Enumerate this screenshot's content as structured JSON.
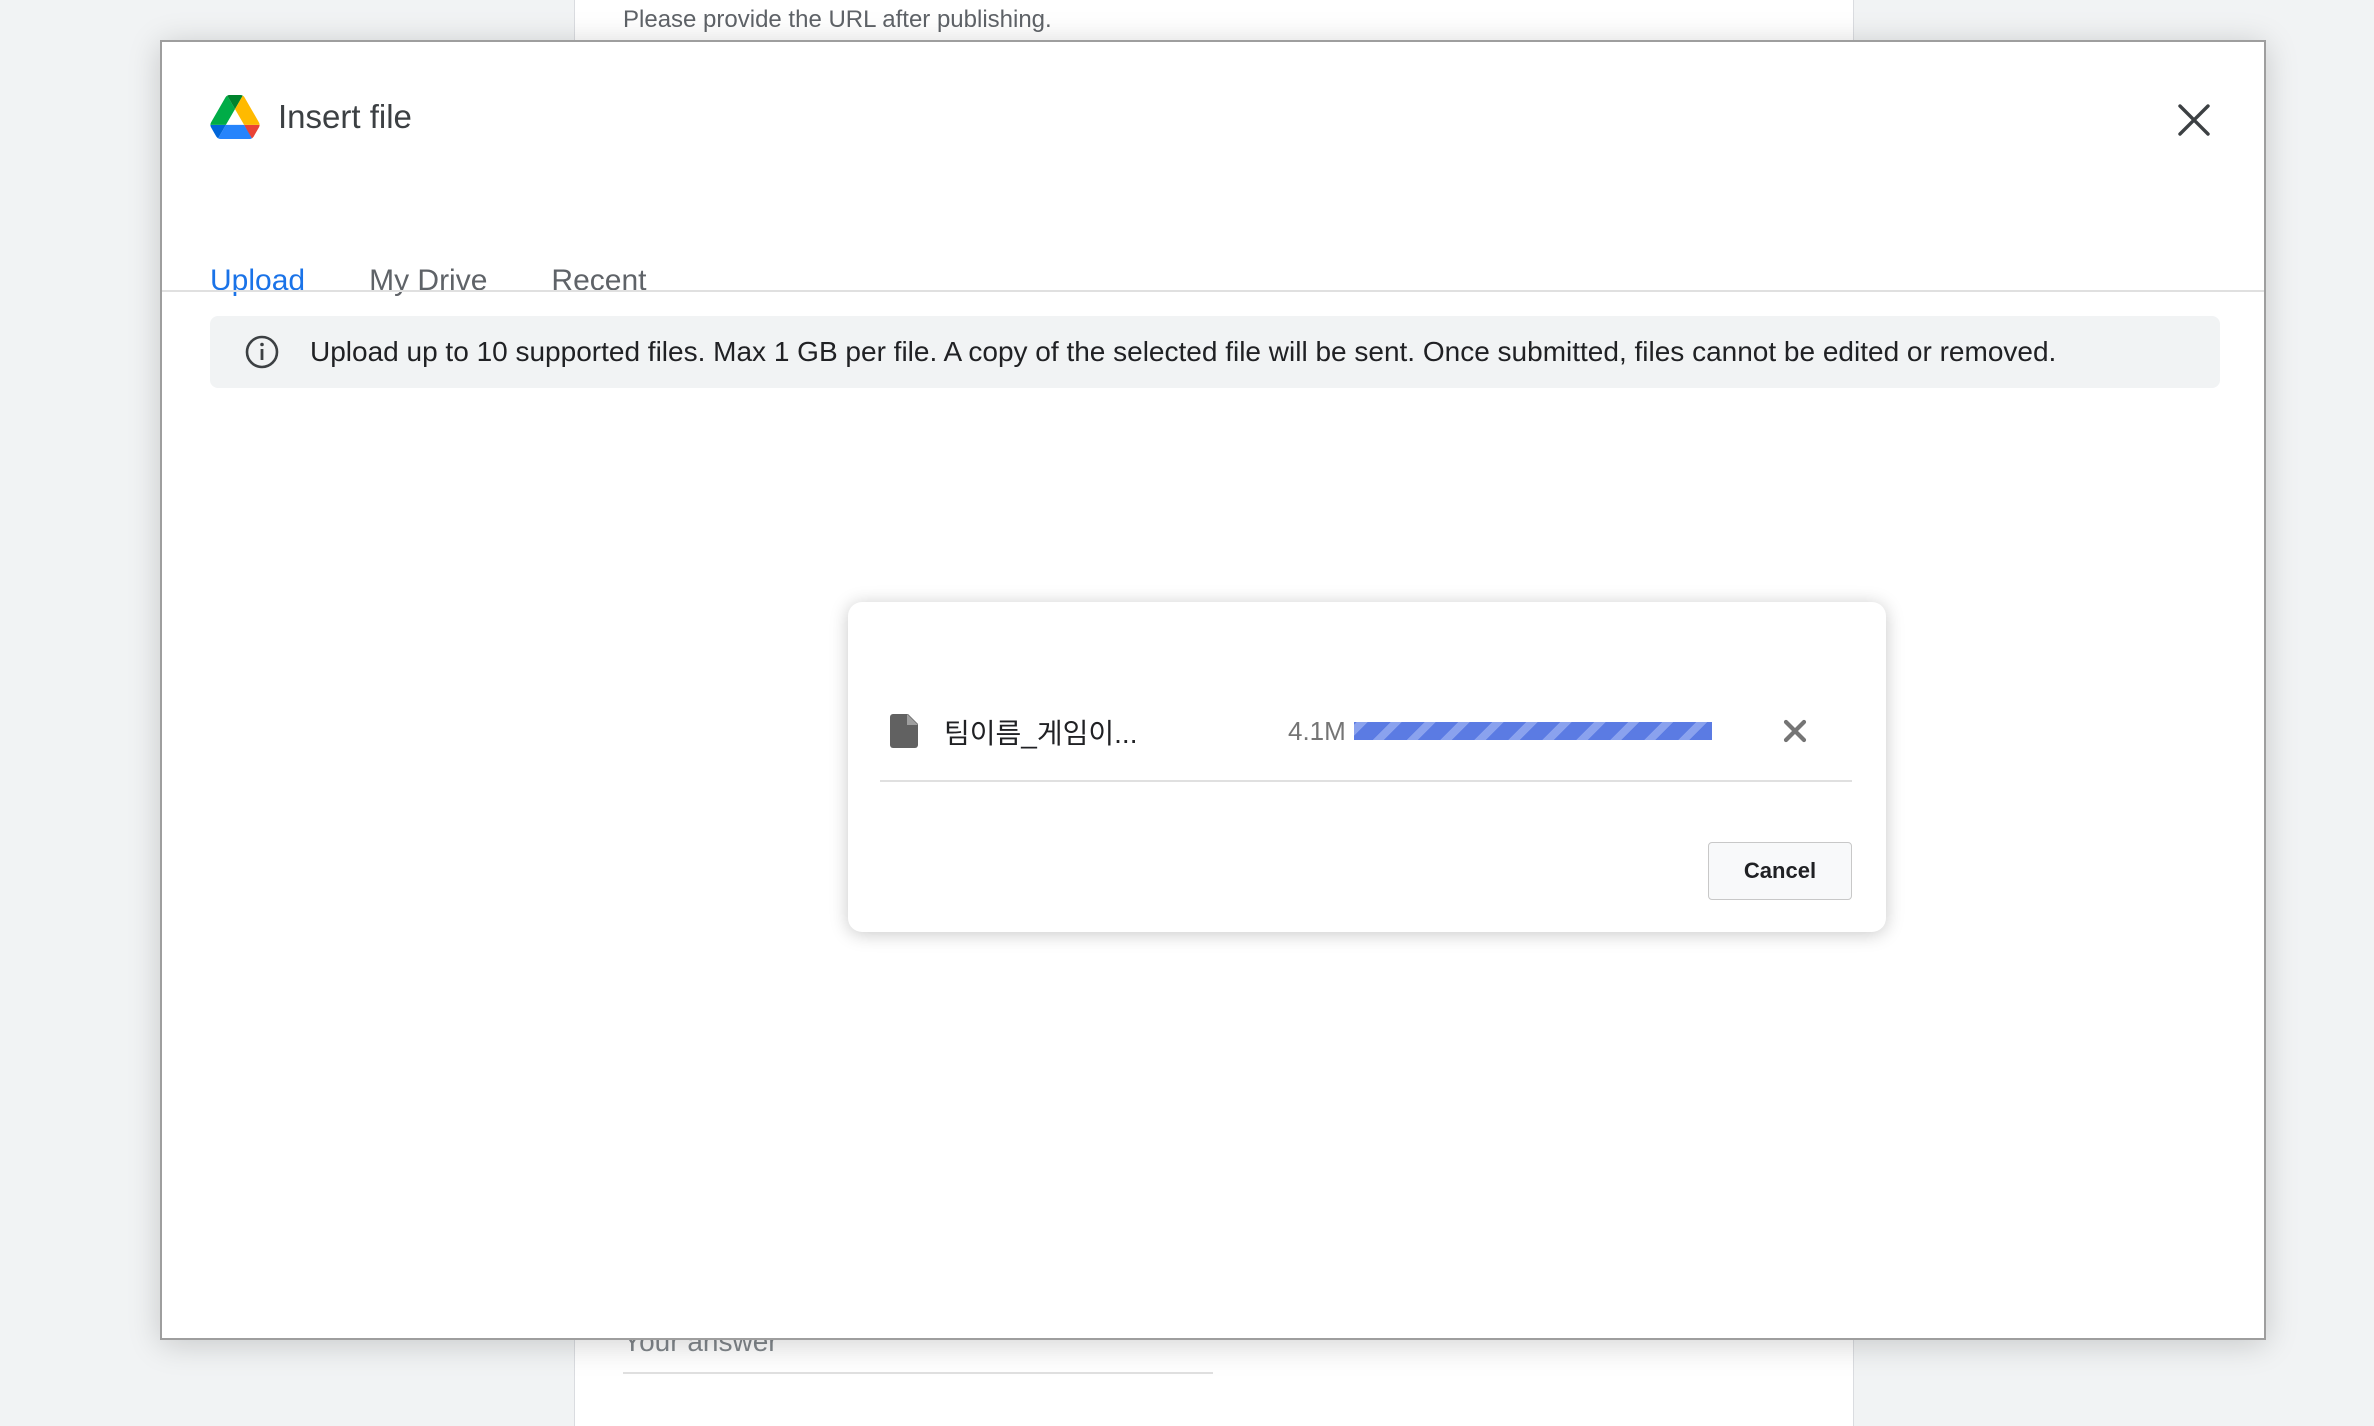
{
  "background": {
    "hint_text": "Please provide the URL after publishing.",
    "answer_placeholder": "Your answer"
  },
  "dialog": {
    "title": "Insert file",
    "logo_icon": "google-drive-icon",
    "close_icon": "close-icon",
    "tabs": [
      {
        "label": "Upload",
        "active": true
      },
      {
        "label": "My Drive",
        "active": false
      },
      {
        "label": "Recent",
        "active": false
      }
    ],
    "notice": {
      "icon": "info-icon",
      "text": "Upload up to 10 supported files. Max 1 GB per file. A copy of the selected file will be sent. Once submitted, files cannot be edited or removed."
    }
  },
  "upload": {
    "file": {
      "icon": "file-icon",
      "name": "팀이름_게임이...",
      "size": "4.1M",
      "progress_percent": 100,
      "remove_icon": "remove-icon"
    },
    "cancel_label": "Cancel"
  },
  "colors": {
    "accent": "#1a73e8",
    "progress": "#5b7be3",
    "notice_bg": "#f1f3f4"
  }
}
